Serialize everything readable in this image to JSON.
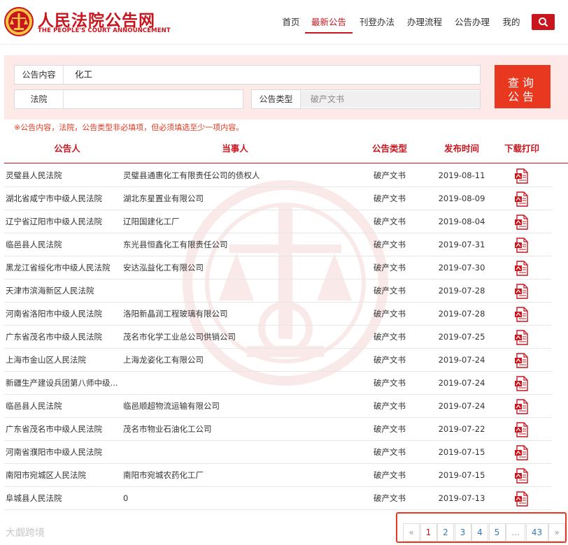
{
  "site": {
    "title": "人民法院公告网",
    "subtitle": "THE PEOPLE'S COURT ANNOUNCEMENT"
  },
  "nav": {
    "items": [
      {
        "label": "首页"
      },
      {
        "label": "最新公告",
        "active": true
      },
      {
        "label": "刊登办法"
      },
      {
        "label": "办理流程"
      },
      {
        "label": "公告办理"
      },
      {
        "label": "我的"
      }
    ]
  },
  "search": {
    "content_label": "公告内容",
    "content_value": "化工",
    "court_label": "法院",
    "court_value": "",
    "type_label": "公告类型",
    "type_value": "破产文书",
    "query_button": "查询公告",
    "hint": "※公告内容，法院，公告类型非必填项，但必须填选至少一项内容。"
  },
  "table": {
    "headers": [
      "公告人",
      "当事人",
      "公告类型",
      "发布时间",
      "下载打印"
    ],
    "rows": [
      {
        "court": "灵璧县人民法院",
        "party": "灵璧县通惠化工有限责任公司的债权人",
        "type": "破产文书",
        "date": "2019-08-11"
      },
      {
        "court": "湖北省咸宁市中级人民法院",
        "party": "湖北东星置业有限公司",
        "type": "破产文书",
        "date": "2019-08-09"
      },
      {
        "court": "辽宁省辽阳市中级人民法院",
        "party": "辽阳国建化工厂",
        "type": "破产文书",
        "date": "2019-08-04"
      },
      {
        "court": "临邑县人民法院",
        "party": "东光县恒鑫化工有限责任公司",
        "type": "破产文书",
        "date": "2019-07-31"
      },
      {
        "court": "黑龙江省绥化市中级人民法院",
        "party": "安达泓益化工有限公司",
        "type": "破产文书",
        "date": "2019-07-30"
      },
      {
        "court": "天津市滨海新区人民法院",
        "party": "",
        "type": "破产文书",
        "date": "2019-07-28"
      },
      {
        "court": "河南省洛阳市中级人民法院",
        "party": "洛阳新晶润工程玻璃有限公司",
        "type": "破产文书",
        "date": "2019-07-28"
      },
      {
        "court": "广东省茂名市中级人民法院",
        "party": "茂名市化学工业总公司供销公司",
        "type": "破产文书",
        "date": "2019-07-25"
      },
      {
        "court": "上海市金山区人民法院",
        "party": "上海龙姿化工有限公司",
        "type": "破产文书",
        "date": "2019-07-24"
      },
      {
        "court": "新疆生产建设兵团第八师中级...",
        "party": "",
        "type": "破产文书",
        "date": "2019-07-24"
      },
      {
        "court": "临邑县人民法院",
        "party": "临邑顺超物流运输有限公司",
        "type": "破产文书",
        "date": "2019-07-24"
      },
      {
        "court": "广东省茂名市中级人民法院",
        "party": "茂名市物业石油化工公司",
        "type": "破产文书",
        "date": "2019-07-22"
      },
      {
        "court": "河南省濮阳市中级人民法院",
        "party": "",
        "type": "破产文书",
        "date": "2019-07-15"
      },
      {
        "court": "南阳市宛城区人民法院",
        "party": "南阳市宛城农药化工厂",
        "type": "破产文书",
        "date": "2019-07-15"
      },
      {
        "court": "阜城县人民法院",
        "party": "0",
        "type": "破产文书",
        "date": "2019-07-13"
      }
    ]
  },
  "pagination": {
    "items": [
      "«",
      "1",
      "2",
      "3",
      "4",
      "5",
      "...",
      "43",
      "»"
    ],
    "current": "1"
  },
  "watermark_text": "大觑跨境",
  "colors": {
    "brand_red": "#c9151e",
    "button_red": "#e8381f",
    "panel_bg": "#fde9e8"
  },
  "icons": {
    "search": "search-icon",
    "download": "pdf-file-icon"
  }
}
